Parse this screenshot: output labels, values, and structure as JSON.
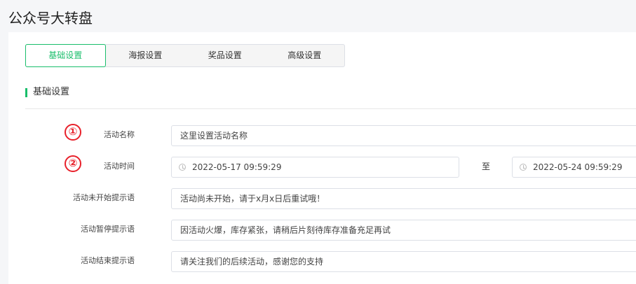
{
  "page": {
    "title": "公众号大转盘"
  },
  "tabs": [
    {
      "label": "基础设置",
      "active": true
    },
    {
      "label": "海报设置"
    },
    {
      "label": "奖品设置"
    },
    {
      "label": "高级设置"
    }
  ],
  "section": {
    "title": "基础设置"
  },
  "annotations": [
    "①",
    "②"
  ],
  "form": {
    "name": {
      "label": "活动名称",
      "value": "这里设置活动名称"
    },
    "time": {
      "label": "活动时间",
      "start": "2022-05-17 09:59:29",
      "separator": "至",
      "end": "2022-05-24 09:59:29"
    },
    "not_started": {
      "label": "活动未开始提示语",
      "value": "活动尚未开始，请于x月x日后重试哦！"
    },
    "paused": {
      "label": "活动暂停提示语",
      "value": "因活动火爆，库存紧张，请稍后片刻待库存准备充足再试"
    },
    "ended": {
      "label": "活动结束提示语",
      "value": "请关注我们的后续活动，感谢您的支持"
    }
  },
  "colors": {
    "accent": "#19be6b",
    "annotation": "#e8202a"
  }
}
